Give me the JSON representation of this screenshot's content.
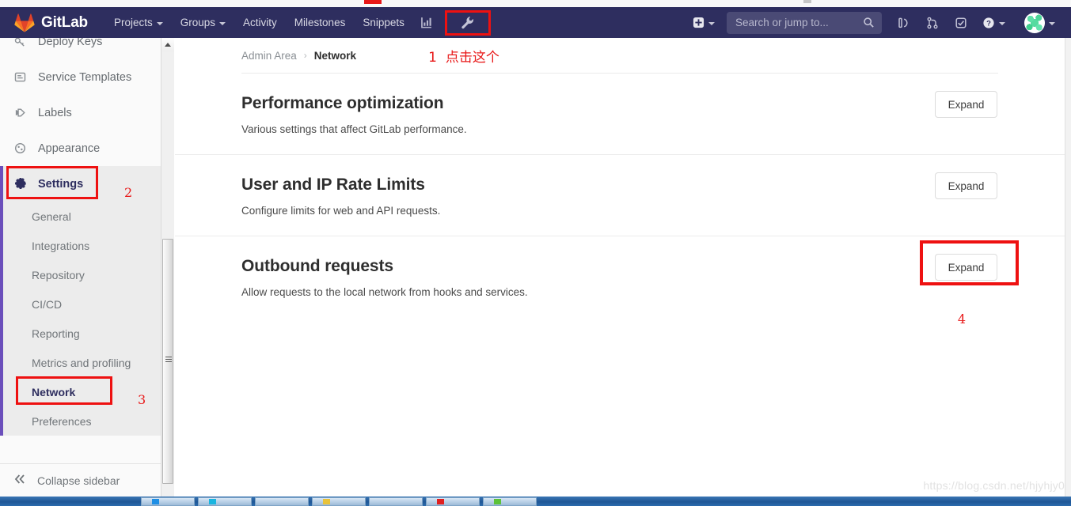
{
  "navbar": {
    "brand": "GitLab",
    "brand_icon": "gitlab-tanuki-logo",
    "links": [
      {
        "label": "Projects",
        "has_caret": true
      },
      {
        "label": "Groups",
        "has_caret": true
      },
      {
        "label": "Activity",
        "has_caret": false
      },
      {
        "label": "Milestones",
        "has_caret": false
      },
      {
        "label": "Snippets",
        "has_caret": false
      }
    ],
    "icons": [
      {
        "name": "analytics-chart-icon"
      },
      {
        "name": "wrench-admin-icon",
        "highlighted": true
      }
    ],
    "right": {
      "new_icon": "plus-square-icon",
      "new_caret": true,
      "search_placeholder": "Search or jump to...",
      "search_value": "",
      "search_icon": "search-icon",
      "issues_icon": "issues-icon",
      "merge_requests_icon": "merge-request-icon",
      "todos_icon": "todos-checkbox-icon",
      "help_icon": "help-question-icon",
      "avatar": "user-avatar",
      "avatar_caret": true
    },
    "bg_color": "#2e2e5f"
  },
  "sidebar": {
    "items": [
      {
        "label": "Deploy Keys",
        "icon": "key-icon",
        "type": "item",
        "clipped": true
      },
      {
        "label": "Service Templates",
        "icon": "template-icon",
        "type": "item"
      },
      {
        "label": "Labels",
        "icon": "labels-icon",
        "type": "item"
      },
      {
        "label": "Appearance",
        "icon": "appearance-palette-icon",
        "type": "item"
      },
      {
        "label": "Settings",
        "icon": "gear-icon",
        "type": "item",
        "active": true
      }
    ],
    "sub_items": [
      {
        "label": "General"
      },
      {
        "label": "Integrations"
      },
      {
        "label": "Repository"
      },
      {
        "label": "CI/CD"
      },
      {
        "label": "Reporting"
      },
      {
        "label": "Metrics and profiling"
      },
      {
        "label": "Network",
        "current": true
      },
      {
        "label": "Preferences"
      }
    ],
    "collapse_label": "Collapse sidebar",
    "collapse_icon": "double-chevron-left-icon",
    "active_accent": "#6b4fbb"
  },
  "breadcrumb": {
    "root": "Admin Area",
    "separator": "›",
    "current": "Network"
  },
  "annotations": {
    "color": "#e81919",
    "one": {
      "num": "1",
      "text": "点击这个"
    },
    "two": "2",
    "three": "3",
    "four": "4"
  },
  "main": {
    "sections": [
      {
        "title": "Performance optimization",
        "description": "Various settings that affect GitLab performance.",
        "button": "Expand",
        "highlighted": false
      },
      {
        "title": "User and IP Rate Limits",
        "description": "Configure limits for web and API requests.",
        "button": "Expand",
        "highlighted": false
      },
      {
        "title": "Outbound requests",
        "description": "Allow requests to the local network from hooks and services.",
        "button": "Expand",
        "highlighted": true
      }
    ]
  },
  "watermark": "https://blog.csdn.net/hjyhjy0"
}
